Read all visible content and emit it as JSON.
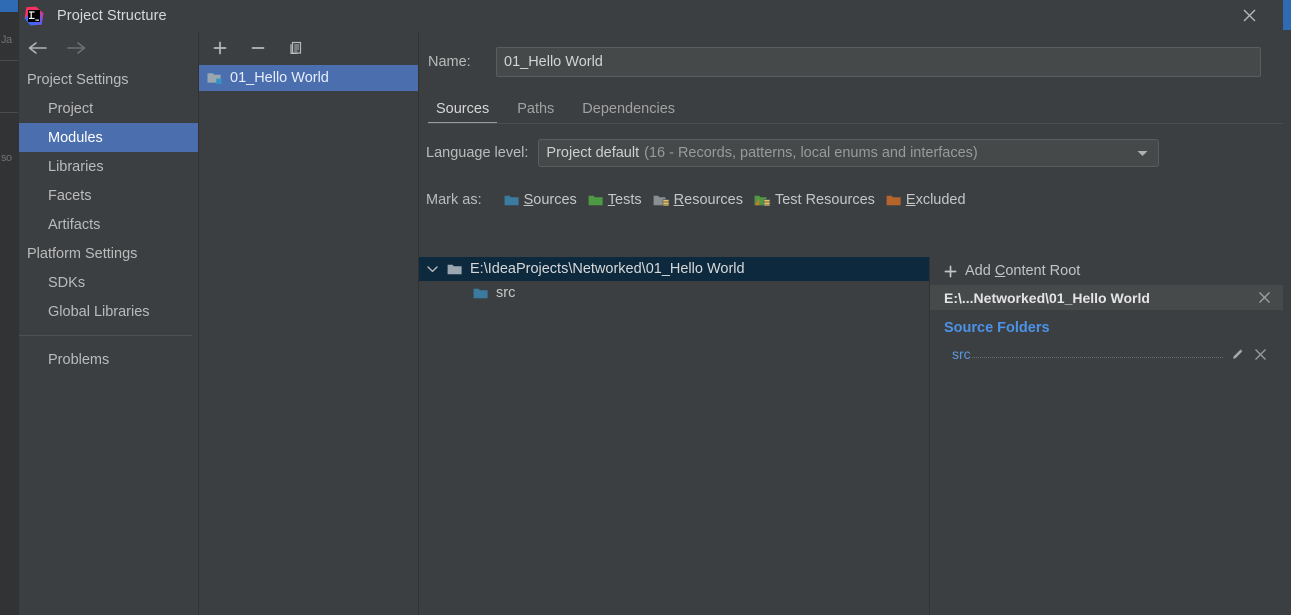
{
  "window": {
    "title": "Project Structure",
    "app_icon": "intellij-idea-logo",
    "close_label": "✕"
  },
  "nav": {
    "back": "back-arrow",
    "forward": "forward-arrow"
  },
  "sidebar": {
    "groups": [
      {
        "label": "Project Settings"
      },
      {
        "label": "Platform Settings"
      }
    ],
    "items": [
      {
        "label": "Project",
        "selected": false
      },
      {
        "label": "Modules",
        "selected": true
      },
      {
        "label": "Libraries",
        "selected": false
      },
      {
        "label": "Facets",
        "selected": false
      },
      {
        "label": "Artifacts",
        "selected": false
      },
      {
        "label": "SDKs",
        "selected": false
      },
      {
        "label": "Global Libraries",
        "selected": false
      },
      {
        "label": "Problems",
        "selected": false
      }
    ]
  },
  "modules_panel": {
    "toolbar": {
      "add": "+",
      "remove": "−",
      "copy": "copy-icon"
    },
    "items": [
      {
        "label": "01_Hello World",
        "selected": true,
        "icon": "module-folder-icon"
      }
    ]
  },
  "detail": {
    "name_label": "Name:",
    "name_value": "01_Hello World",
    "name_placeholder": "",
    "tabs": [
      {
        "label": "Sources",
        "active": true
      },
      {
        "label": "Paths",
        "active": false
      },
      {
        "label": "Dependencies",
        "active": false
      }
    ],
    "language_level": {
      "label": "Language level:",
      "value_main": "Project default",
      "value_detail": "(16 - Records, patterns, local enums and interfaces)"
    },
    "mark_as": {
      "label": "Mark as:",
      "options": [
        {
          "label": "Sources",
          "mnemonic": "S",
          "rest": "ources",
          "color": "#3b7ba0",
          "icon": "sources-folder-icon"
        },
        {
          "label": "Tests",
          "mnemonic": "T",
          "rest": "ests",
          "color": "#4e9a44",
          "icon": "tests-folder-icon"
        },
        {
          "label": "Resources",
          "mnemonic": "R",
          "rest": "esources",
          "color": "#8a8f93",
          "icon": "resources-folder-icon"
        },
        {
          "label": "Test Resources",
          "mnemonic": "",
          "rest": "Test Resources",
          "color": "#4e9a44",
          "icon": "test-resources-folder-icon"
        },
        {
          "label": "Excluded",
          "mnemonic": "E",
          "rest": "xcluded",
          "color": "#b5642b",
          "icon": "excluded-folder-icon"
        }
      ]
    },
    "content_tree": [
      {
        "label": "E:\\IdeaProjects\\Networked\\01_Hello World",
        "selected": true,
        "expanded": true,
        "depth": 0,
        "icon": "content-root-folder-icon"
      },
      {
        "label": "src",
        "selected": false,
        "expanded": false,
        "depth": 1,
        "icon": "source-folder-icon"
      }
    ],
    "content_roots": {
      "add_button": {
        "plus": "+",
        "pre": "Add ",
        "mnemonic": "C",
        "post": "ontent Root"
      },
      "root_path": "E:\\...Networked\\01_Hello World",
      "root_remove": "✕",
      "sections": [
        {
          "title": "Source Folders",
          "folders": [
            {
              "name": "src",
              "edit_icon": "pencil-icon",
              "remove_icon": "close-icon"
            }
          ]
        }
      ]
    }
  },
  "backdrop": {
    "ghost_text": [
      "Ja",
      "so"
    ]
  },
  "colors": {
    "dialog_bg": "#3c3f41",
    "selection_blue": "#4b6eaf",
    "tree_selection": "#0d293e",
    "link_blue": "#4c92e8",
    "accent_orange": "#b5642b"
  }
}
